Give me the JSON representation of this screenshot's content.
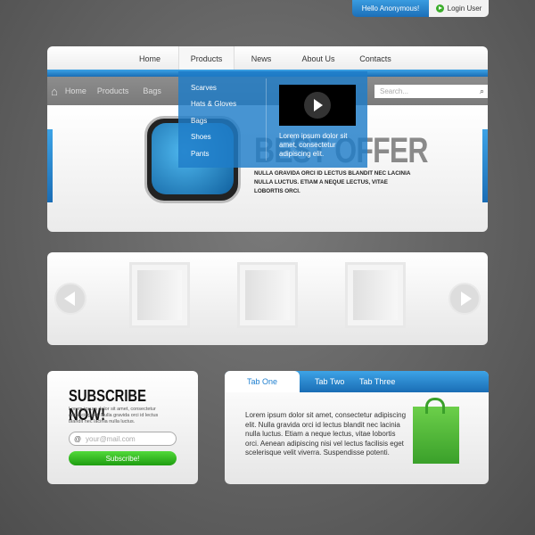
{
  "user_bar": {
    "greeting": "Hello Anonymous!",
    "login": "Login User"
  },
  "nav": {
    "items": [
      "Home",
      "Products",
      "News",
      "About Us",
      "Contacts"
    ],
    "active": "Products"
  },
  "breadcrumb": [
    "Home",
    "Products",
    "Bags"
  ],
  "search": {
    "placeholder": "Search..."
  },
  "dropdown": {
    "items": [
      "Scarves",
      "Hats & Gloves",
      "Bags",
      "Shoes",
      "Pants"
    ],
    "text": "Lorem ipsum dolor sit amet, consectetur adipiscing elit."
  },
  "hero": {
    "title": "BEST OFFER",
    "subtitle": "NULLA GRAVIDA ORCI ID LECTUS BLANDIT NEC LACINIA NULLA LUCTUS. ETIAM A NEQUE LECTUS, VITAE LOBORTIS ORCI."
  },
  "subscribe": {
    "title": "SUBSCRIBE NOW!",
    "text": "Lorem ipsum dolor sit amet, consectetur adipiscing elit. Nulla gravida orci id lectus blandit nec lacinia nulla luctus.",
    "placeholder": "your@mail.com",
    "button": "Subscribe!"
  },
  "tabs": {
    "items": [
      "Tab One",
      "Tab Two",
      "Tab Three"
    ],
    "active": "Tab One",
    "content": "Lorem ipsum dolor sit amet, consectetur adipiscing elit. Nulla gravida orci id lectus blandit nec lacinia nulla luctus. Etiam a neque lectus, vitae lobortis orci. Aenean adipiscing nisi vel lectus facilisis eget scelerisque velit viverra. Suspendisse potenti."
  },
  "colors": {
    "accent": "#1e7fd0",
    "green": "#2db51b"
  }
}
